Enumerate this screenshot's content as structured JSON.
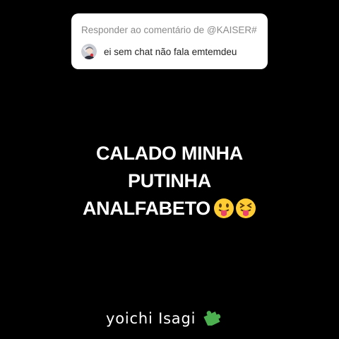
{
  "reply_card": {
    "header": "Responder ao comentário de @KAISER#",
    "comment": "ei sem chat não fala emtemdeu",
    "avatar_icon": "user-avatar"
  },
  "reply_text": {
    "lines": [
      "CALADO MINHA",
      "PUTINHA",
      "ANALFABETO"
    ],
    "emojis": [
      "face-with-tongue-icon",
      "squinting-face-with-tongue-icon"
    ]
  },
  "watermark": {
    "text": "yoichi Isagi",
    "icon": "puzzle-piece-icon",
    "icon_color": "#4caf50"
  },
  "colors": {
    "background": "#000000",
    "card": "#ffffff",
    "header_text": "#8a8a8a",
    "comment_text": "#222222",
    "main_text": "#ffffff"
  }
}
